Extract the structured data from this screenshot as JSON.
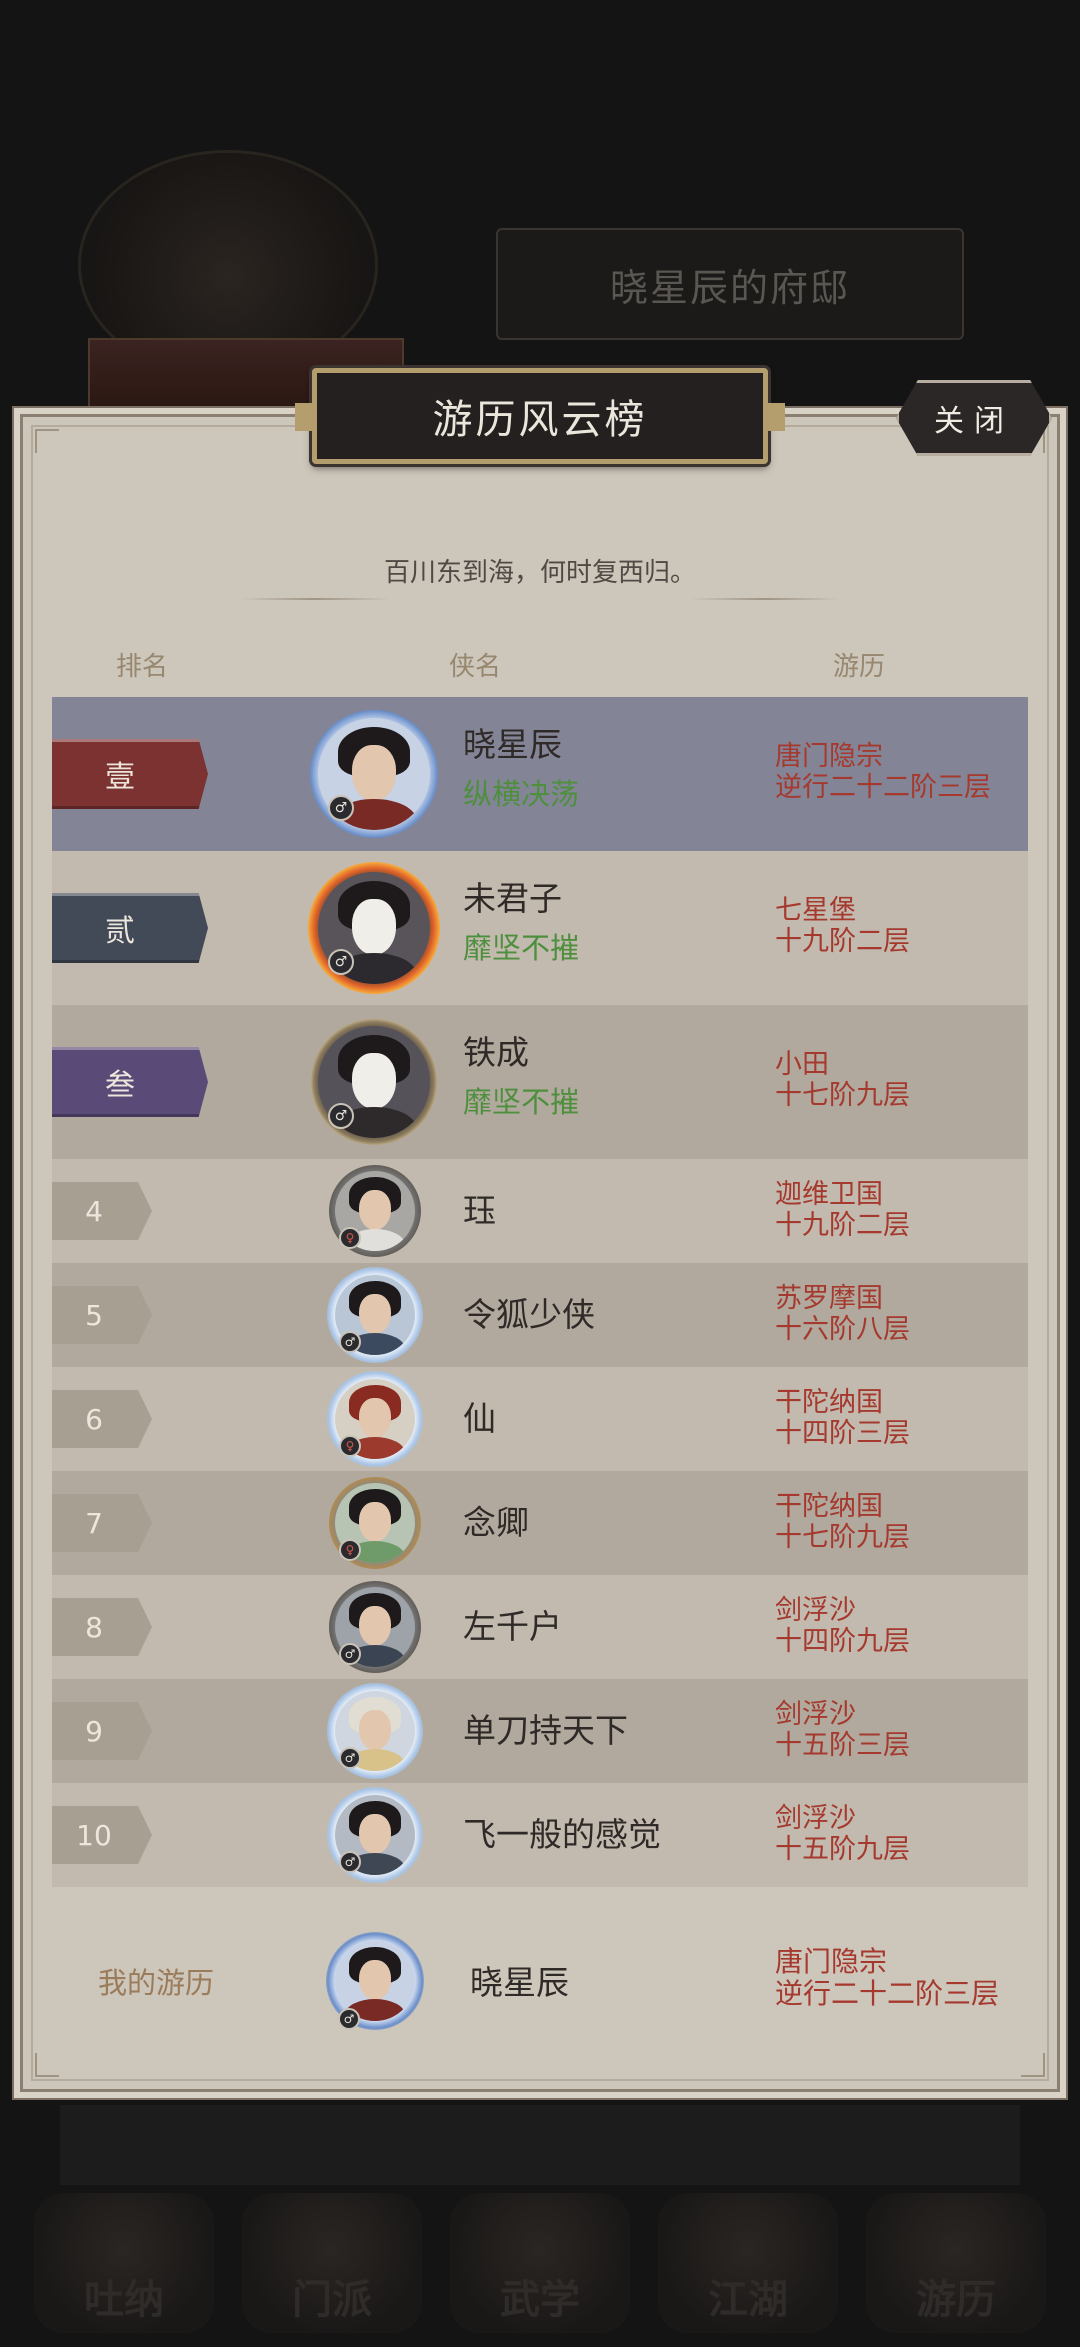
{
  "background": {
    "mansion_title": "晓星辰的府邸",
    "nav": [
      "吐纳",
      "门派",
      "武学",
      "江湖",
      "游历"
    ]
  },
  "dialog": {
    "title": "游历风云榜",
    "close_label": "关闭",
    "subtitle": "百川东到海，何时复西归。",
    "headers": {
      "rank": "排名",
      "name": "侠名",
      "exp": "游历"
    }
  },
  "rows": [
    {
      "rank": "壹",
      "name": "晓星辰",
      "title": "纵横决荡",
      "place": "唐门隐宗",
      "level": "逆行二十二阶三层",
      "rank_color": "#7c3230",
      "avatar": "red-headband-warrior"
    },
    {
      "rank": "贰",
      "name": "未君子",
      "title": "靡坚不摧",
      "place": "七星堡",
      "level": "十九阶二层",
      "rank_color": "#424a57",
      "avatar": "masked-swordsman-flame"
    },
    {
      "rank": "叁",
      "name": "铁成",
      "title": "靡坚不摧",
      "place": "小田",
      "level": "十七阶九层",
      "rank_color": "#5a4a78",
      "avatar": "masked-swordsman"
    },
    {
      "rank": "4",
      "name": "珏",
      "title": "",
      "place": "迦维卫国",
      "level": "十九阶二层",
      "avatar": "long-hair-female"
    },
    {
      "rank": "5",
      "name": "令狐少侠",
      "title": "",
      "place": "苏罗摩国",
      "level": "十六阶八层",
      "avatar": "swordsman"
    },
    {
      "rank": "6",
      "name": "仙",
      "title": "",
      "place": "干陀纳国",
      "level": "十四阶三层",
      "avatar": "red-headdress-female"
    },
    {
      "rank": "7",
      "name": "念卿",
      "title": "",
      "place": "干陀纳国",
      "level": "十七阶九层",
      "avatar": "green-robe-female"
    },
    {
      "rank": "8",
      "name": "左千户",
      "title": "",
      "place": "剑浮沙",
      "level": "十四阶九层",
      "avatar": "dark-robe-male"
    },
    {
      "rank": "9",
      "name": "单刀持天下",
      "title": "",
      "place": "剑浮沙",
      "level": "十五阶三层",
      "avatar": "bald-monk"
    },
    {
      "rank": "10",
      "name": "飞一般的感觉",
      "title": "",
      "place": "剑浮沙",
      "level": "十五阶九层",
      "avatar": "young-swordsman"
    }
  ],
  "mine": {
    "label": "我的游历",
    "name": "晓星辰",
    "place": "唐门隐宗",
    "level": "逆行二十二阶三层"
  }
}
